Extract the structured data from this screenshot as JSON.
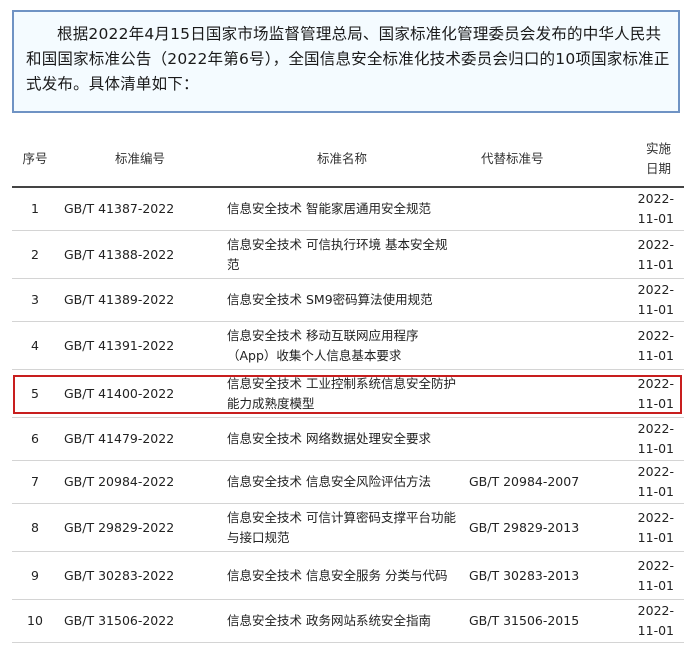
{
  "intro": {
    "text": "根据2022年4月15日国家市场监督管理总局、国家标准化管理委员会发布的中华人民共和国国家标准公告（2022年第6号），全国信息安全标准化技术委员会归口的10项国家标准正式发布。具体清单如下："
  },
  "table": {
    "headers": {
      "no": "序号",
      "code": "标准编号",
      "name": "标准名称",
      "replaced": "代替标准号",
      "date_line1": "实施",
      "date_line2": "日期"
    },
    "rows": [
      {
        "no": "1",
        "code": "GB/T 41387-2022",
        "name": "信息安全技术 智能家居通用安全规范",
        "replaced": "",
        "date": "2022-11-01"
      },
      {
        "no": "2",
        "code": "GB/T 41388-2022",
        "name": "信息安全技术 可信执行环境 基本安全规范",
        "replaced": "",
        "date": "2022-11-01"
      },
      {
        "no": "3",
        "code": "GB/T 41389-2022",
        "name": "信息安全技术 SM9密码算法使用规范",
        "replaced": "",
        "date": "2022-11-01"
      },
      {
        "no": "4",
        "code": "GB/T 41391-2022",
        "name": "信息安全技术 移动互联网应用程序（App）收集个人信息基本要求",
        "replaced": "",
        "date": "2022-11-01"
      },
      {
        "no": "5",
        "code": "GB/T 41400-2022",
        "name": "信息安全技术 工业控制系统信息安全防护能力成熟度模型",
        "replaced": "",
        "date": "2022-11-01"
      },
      {
        "no": "6",
        "code": "GB/T 41479-2022",
        "name": "信息安全技术 网络数据处理安全要求",
        "replaced": "",
        "date": "2022-11-01"
      },
      {
        "no": "7",
        "code": "GB/T 20984-2022",
        "name": "信息安全技术 信息安全风险评估方法",
        "replaced": "GB/T 20984-2007",
        "date": "2022-11-01"
      },
      {
        "no": "8",
        "code": "GB/T 29829-2022",
        "name": "信息安全技术 可信计算密码支撑平台功能与接口规范",
        "replaced": "GB/T 29829-2013",
        "date": "2022-11-01"
      },
      {
        "no": "9",
        "code": "GB/T 30283-2022",
        "name": "信息安全技术 信息安全服务 分类与代码",
        "replaced": "GB/T 30283-2013",
        "date": "2022-11-01"
      },
      {
        "no": "10",
        "code": "GB/T 31506-2022",
        "name": "信息安全技术 政务网站系统安全指南",
        "replaced": "GB/T 31506-2015",
        "date": "2022-11-01"
      }
    ]
  },
  "highlight_color": "#c81e1e",
  "box_border_color": "#6f93c4"
}
